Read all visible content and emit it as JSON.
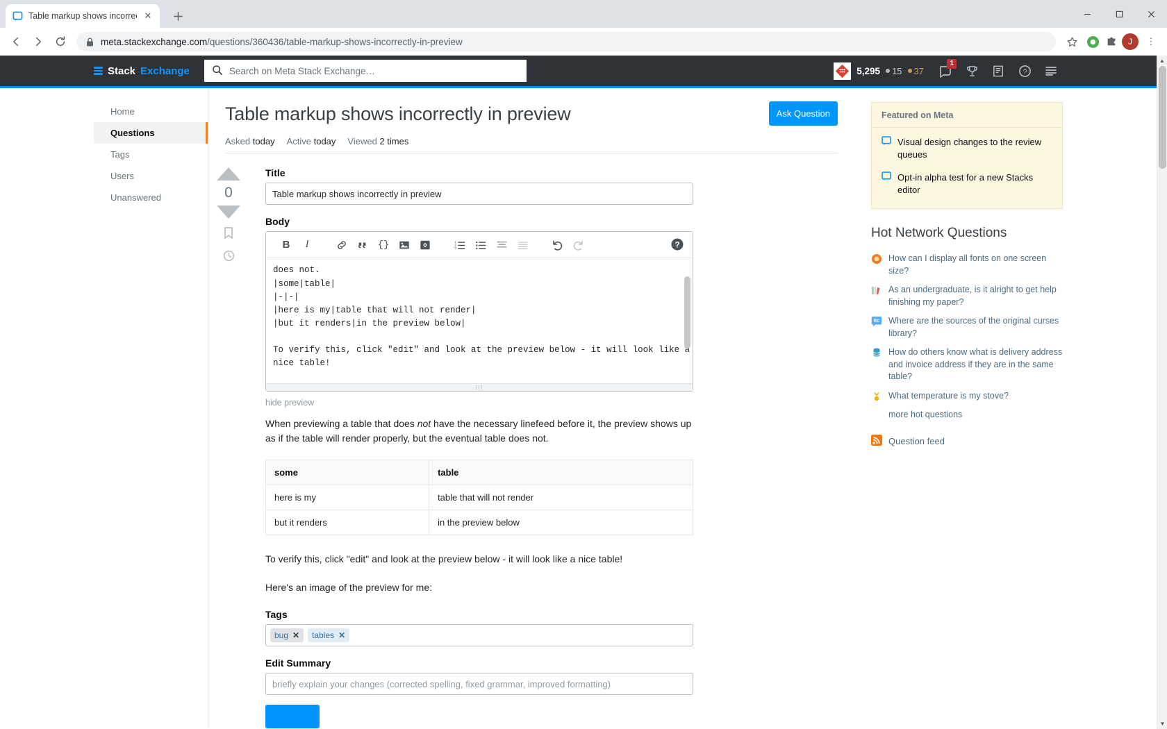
{
  "browser": {
    "tab": {
      "title": "Table markup shows incorrectly i",
      "favicon": "stack-exchange-icon",
      "close": "✕"
    },
    "newtab_label": "+",
    "window": {
      "minimize": "─",
      "maximize": "☐",
      "close": "✕"
    },
    "nav": {
      "back": "←",
      "forward": "→",
      "reload": "⟳"
    },
    "omnibox": {
      "lock": "lock-icon",
      "url_domain": "meta.stackexchange.com",
      "url_path": "/questions/360436/table-markup-shows-incorrectly-in-preview"
    },
    "actions": {
      "bookmark": "☆",
      "ext1": "extension-green-icon",
      "ext2": "puzzle-icon",
      "profile": "J",
      "menu": "⋮"
    }
  },
  "site_header": {
    "logo_prefix": "Stack",
    "logo_suffix": "Exchange",
    "search_placeholder": "Search on Meta Stack Exchange…",
    "reputation": "5,295",
    "silver_badges": "15",
    "gold_badges": "37",
    "notification_count": "1",
    "icons": [
      "inbox-icon",
      "trophy-icon",
      "review-icon",
      "help-icon",
      "site-switcher-icon"
    ]
  },
  "left_nav": {
    "items": [
      {
        "label": "Home",
        "active": false
      },
      {
        "label": "Questions",
        "active": true
      },
      {
        "label": "Tags",
        "active": false
      },
      {
        "label": "Users",
        "active": false
      },
      {
        "label": "Unanswered",
        "active": false
      }
    ]
  },
  "question": {
    "title": "Table markup shows incorrectly in preview",
    "meta": [
      {
        "label": "Asked",
        "value": "today"
      },
      {
        "label": "Active",
        "value": "today"
      },
      {
        "label": "Viewed",
        "value": "2 times"
      }
    ],
    "ask_button": "Ask Question",
    "vote_count": "0"
  },
  "editor": {
    "title_label": "Title",
    "title_value": "Table markup shows incorrectly in preview",
    "body_label": "Body",
    "toolbar": [
      {
        "name": "bold-icon",
        "glyph": "B"
      },
      {
        "name": "italic-icon",
        "glyph": "I"
      },
      {
        "name": "link-icon",
        "glyph": "link"
      },
      {
        "name": "blockquote-icon",
        "glyph": "”"
      },
      {
        "name": "code-icon",
        "glyph": "{}"
      },
      {
        "name": "image-icon",
        "glyph": "image"
      },
      {
        "name": "stack-snippet-icon",
        "glyph": "snippet"
      },
      {
        "name": "ordered-list-icon",
        "glyph": "ol"
      },
      {
        "name": "bulleted-list-icon",
        "glyph": "ul"
      },
      {
        "name": "heading-icon",
        "glyph": "h"
      },
      {
        "name": "horizontal-rule-icon",
        "glyph": "hr"
      },
      {
        "name": "undo-icon",
        "glyph": "↶"
      },
      {
        "name": "redo-icon",
        "glyph": "↷"
      },
      {
        "name": "help-icon",
        "glyph": "?"
      }
    ],
    "body_text": "does not.\n|some|table|\n|-|-|\n|here is my|table that will not render|\n|but it renders|in the preview below|\n\nTo verify this, click \"edit\" and look at the preview below - it will look like a\nnice table!\n\nHere's an image of the preview for me:",
    "hide_preview": "hide preview",
    "tags_label": "Tags",
    "tags": [
      {
        "name": "bug",
        "remove": "✕",
        "style": "bug"
      },
      {
        "name": "tables",
        "remove": "✕",
        "style": "tables"
      }
    ],
    "edit_summary_label": "Edit Summary",
    "edit_summary_placeholder": "briefly explain your changes (corrected spelling, fixed grammar, improved formatting)"
  },
  "preview": {
    "paragraph_pre": "When previewing a table that does ",
    "paragraph_em": "not",
    "paragraph_post": " have the necessary linefeed before it, the preview shows up as if the table will render properly, but the eventual table does not.",
    "table": {
      "headers": [
        "some",
        "table"
      ],
      "rows": [
        [
          "here is my",
          "table that will not render"
        ],
        [
          "but it renders",
          "in the preview below"
        ]
      ]
    },
    "p2": "To verify this, click \"edit\" and look at the preview below - it will look like a nice table!",
    "p3": "Here's an image of the preview for me:"
  },
  "sidebar": {
    "featured_title": "Featured on Meta",
    "featured_items": [
      "Visual design changes to the review queues",
      "Opt-in alpha test for a new Stacks editor"
    ],
    "hot_title": "Hot Network Questions",
    "hot_items": [
      {
        "text": "How can I display all fonts on one screen size?",
        "icon_color": "#f47b20"
      },
      {
        "text": "As an undergraduate, is it alright to get help finishing my paper?",
        "icon_color": "#c4c9cc"
      },
      {
        "text": "Where are the sources of the original curses library?",
        "icon_color": "#5badf0"
      },
      {
        "text": "How do others know what is delivery address and invoice address if they are in the same table?",
        "icon_color": "#2f9fd0"
      },
      {
        "text": "What temperature is my stove?",
        "icon_color": "#f2b705"
      }
    ],
    "more_hot": "more hot questions",
    "question_feed": "Question feed"
  },
  "colors": {
    "accent_blue": "#0095ff",
    "se_blue": "#0a95ff",
    "header_bg": "#2f3337",
    "featured_bg": "#fdf7e2",
    "orange": "#f48024"
  }
}
